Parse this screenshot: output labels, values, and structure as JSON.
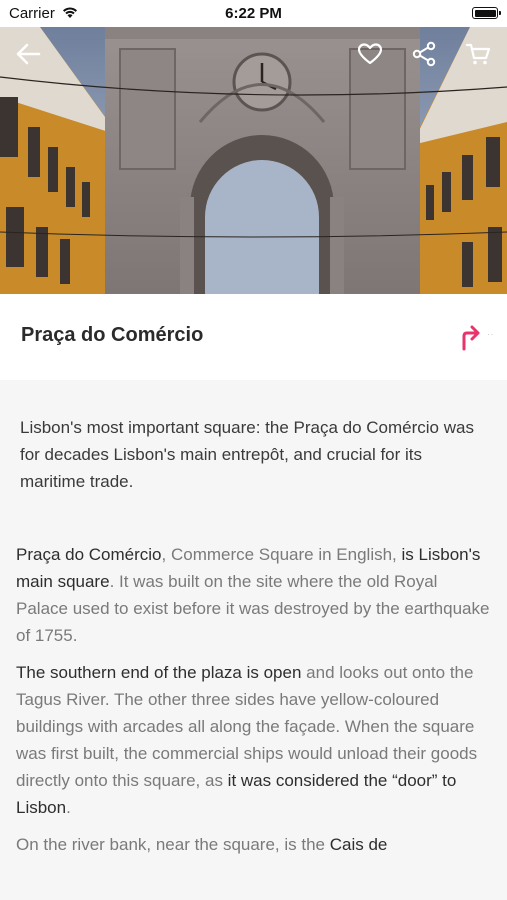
{
  "status": {
    "carrier": "Carrier",
    "time": "6:22 PM"
  },
  "hero": {
    "icons": [
      "back-arrow-icon",
      "heart-icon",
      "share-icon",
      "cart-icon"
    ]
  },
  "place": {
    "title": "Praça do Comércio",
    "directions_icon": "directions-arrow-icon",
    "directions_accent": "#e8336b"
  },
  "summary": "Lisbon's most important square: the Praça do Comércio was for decades Lisbon's main entrepôt, and crucial for its maritime trade.",
  "article": {
    "p1": {
      "s1": "Praça do Comércio",
      "s2": ", Commerce Square in English, ",
      "s3": "is Lisbon's main square",
      "s4": ". It was built on the site where the old Royal Palace used to exist before it was destroyed by the earthquake of 1755."
    },
    "p2": {
      "s1": "The southern end of the plaza is open",
      "s2": " and looks out onto the Tagus River. The other three sides have yellow-coloured buildings with arcades all along the façade. When the square was first built, the commercial ships would unload their goods directly onto this square, as ",
      "s3": "it was considered the “door” to Lisbon",
      "s4": "."
    },
    "p3": {
      "s1": "On the river bank, near the square, is the ",
      "s2": "Cais de"
    }
  }
}
